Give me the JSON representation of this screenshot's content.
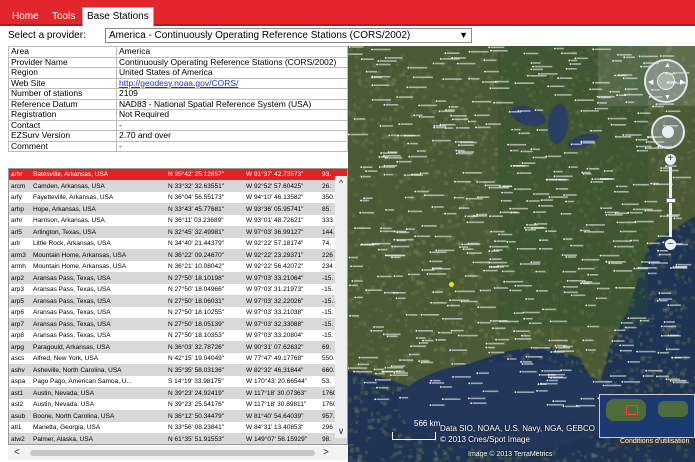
{
  "menu": {
    "tabs": [
      {
        "label": "Home"
      },
      {
        "label": "Tools"
      },
      {
        "label": "Base Stations",
        "active": true
      }
    ],
    "accent": "#e3262b"
  },
  "provider": {
    "label": "Select a provider:",
    "selected": "America - Continuously Operating Reference Stations (CORS/2002)"
  },
  "info": {
    "rows": [
      {
        "key": "Area",
        "value": "America"
      },
      {
        "key": "Provider Name",
        "value": "Continuously Operating Reference Stations (CORS/2002)"
      },
      {
        "key": "Region",
        "value": "United States of America"
      },
      {
        "key": "Web Site",
        "value": "http://geodesy.noaa.gov/CORS/",
        "link": true
      },
      {
        "key": "Number of stations",
        "value": "2109"
      },
      {
        "key": "Reference Datum",
        "value": "NAD83 - National Spatial Reference System (USA)"
      },
      {
        "key": "Registration",
        "value": "Not Required"
      },
      {
        "key": "Contact",
        "value": "-"
      },
      {
        "key": "EZSurv Version",
        "value": "2.70 and over"
      },
      {
        "key": "Comment",
        "value": "-"
      }
    ]
  },
  "stations": {
    "rows": [
      {
        "code": "arbr",
        "name": "Batesville, Arkansas, USA",
        "lat": "N 35°42' 25.12657\"",
        "lon": "W 91°37' 42.73573\"",
        "h": "93."
      },
      {
        "code": "arcm",
        "name": "Camden, Arkansas, USA",
        "lat": "N 33°32' 32.63551\"",
        "lon": "W 92°52' 57.60425\"",
        "h": "26."
      },
      {
        "code": "arfy",
        "name": "Fayetteville, Arkansas, USA",
        "lat": "N 36°04' 56.55173\"",
        "lon": "W 94°10' 46.13582\"",
        "h": "350."
      },
      {
        "code": "arhp",
        "name": "Hope, Arkansas, USA",
        "lat": "N 33°43' 45.77681\"",
        "lon": "W 93°36' 05.95741\"",
        "h": "85."
      },
      {
        "code": "arhr",
        "name": "Harrison, Arkansas, USA",
        "lat": "N 36°11' 03.23689\"",
        "lon": "W 93°01' 48.72621\"",
        "h": "333."
      },
      {
        "code": "arl5",
        "name": "Arlington, Texas, USA",
        "lat": "N 32°45' 32.49981\"",
        "lon": "W 97°03' 36.99127\"",
        "h": "144."
      },
      {
        "code": "arlr",
        "name": "Little Rock, Arkansas, USA",
        "lat": "N 34°40' 21.44379\"",
        "lon": "W 92°22' 57.18174\"",
        "h": "74."
      },
      {
        "code": "arm3",
        "name": "Mountain Home, Arkansas, USA",
        "lat": "N 36°22' 09.24670\"",
        "lon": "W 92°22' 23.29371\"",
        "h": "226"
      },
      {
        "code": "armh",
        "name": "Mountain Home, Arkansas, USA",
        "lat": "N 36°21' 10.08042\"",
        "lon": "W 92°22' 56.42072\"",
        "h": "234"
      },
      {
        "code": "arp2",
        "name": "Aransas Pass, Texas, USA",
        "lat": "N 27°50' 18.10198\"",
        "lon": "W 97°03' 33.21064\"",
        "h": "-15."
      },
      {
        "code": "arp3",
        "name": "Aransas Pass, Texas, USA",
        "lat": "N 27°50' 18.04966\"",
        "lon": "W 97°03' 31.21973\"",
        "h": "-15."
      },
      {
        "code": "arp5",
        "name": "Aransas Pass, Texas, USA",
        "lat": "N 27°50' 18.06031\"",
        "lon": "W 97°03' 32.22026\"",
        "h": "-15."
      },
      {
        "code": "arp6",
        "name": "Aransas Pass, Texas, USA",
        "lat": "N 27°50' 18.10255\"",
        "lon": "W 97°03' 33.21038\"",
        "h": "-15."
      },
      {
        "code": "arp7",
        "name": "Aransas Pass, Texas, USA",
        "lat": "N 27°50' 18.05139\"",
        "lon": "W 97°03' 32.33088\"",
        "h": "-15."
      },
      {
        "code": "arp8",
        "name": "Aransas Pass, Texas, USA",
        "lat": "N 27°50' 18.10353\"",
        "lon": "W 97°03' 33.20804\"",
        "h": "-15."
      },
      {
        "code": "arpg",
        "name": "Paragould, Arkansas, USA",
        "lat": "N 36°03' 32.78726\"",
        "lon": "W 90°31' 07.62632\"",
        "h": "69."
      },
      {
        "code": "ascs",
        "name": "Alfred, New York, USA",
        "lat": "N 42°15' 19.04049\"",
        "lon": "W 77°47' 49.17768\"",
        "h": "550."
      },
      {
        "code": "ashv",
        "name": "Asheville, North Carolina, USA",
        "lat": "N 35°35' 58.03136\"",
        "lon": "W 82°32' 46.31844\"",
        "h": "660."
      },
      {
        "code": "aspa",
        "name": "Pago Pago, American Samoa, U...",
        "lat": "S 14°19' 33.98175\"",
        "lon": "W 170°43' 20.66544\"",
        "h": "53."
      },
      {
        "code": "ast1",
        "name": "Austin, Nevada, USA",
        "lat": "N 39°23' 24.92419\"",
        "lon": "W 117°18' 30.07363\"",
        "h": "1760."
      },
      {
        "code": "ast2",
        "name": "Austin, Nevada, USA",
        "lat": "N 39°23' 25.54176\"",
        "lon": "W 117°18' 30.89811\"",
        "h": "1760."
      },
      {
        "code": "asub",
        "name": "Boone, North Carolina, USA",
        "lat": "N 36°12' 50.34479\"",
        "lon": "W 81°40' 54.64039\"",
        "h": "957."
      },
      {
        "code": "atl1",
        "name": "Marietta, Georgia, USA",
        "lat": "N 33°56' 08.23841\"",
        "lon": "W 84°31' 13.40853\"",
        "h": "296"
      },
      {
        "code": "atw2",
        "name": "Palmer, Alaska, USA",
        "lat": "N 61°35' 51.91553\"",
        "lon": "W 149°07' 56.15929\"",
        "h": "98."
      },
      {
        "code": "aubn",
        "name": "Auburn, Indiana, USA",
        "lat": "N 41°21' 57.49400\"",
        "lon": "W 85°03' 15.87018\"",
        "h": "244."
      }
    ]
  },
  "map": {
    "scale_label": "566 km",
    "attribution_lines": [
      "Data SIO, NOAA, U.S. Navy, NGA, GEBCO",
      "© 2013 Cnes/Spot Image"
    ],
    "image_credit": "Image © 2013 TerraMetrics",
    "overview_label": "Conditions d'utilisation"
  }
}
